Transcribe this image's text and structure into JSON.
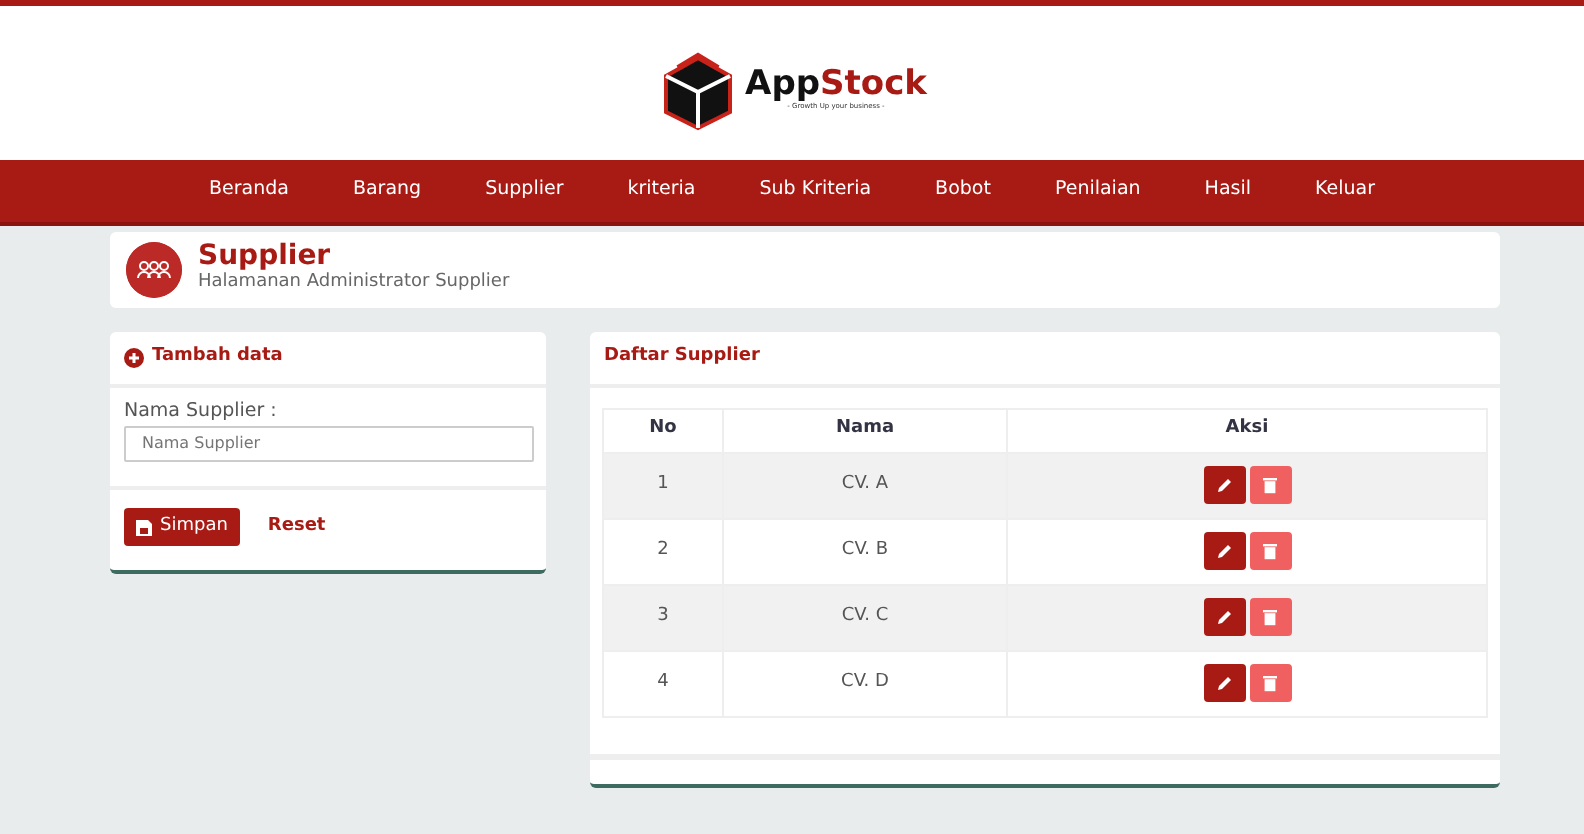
{
  "brand": {
    "name_part1": "App",
    "name_part2": "Stock",
    "tagline": "- Growth Up your business -"
  },
  "nav": [
    "Beranda",
    "Barang",
    "Supplier",
    "kriteria",
    "Sub Kriteria",
    "Bobot",
    "Penilaian",
    "Hasil",
    "Keluar"
  ],
  "page_header": {
    "title": "Supplier",
    "subtitle": "Halamanan Administrator Supplier"
  },
  "form": {
    "title": "Tambah data",
    "label": "Nama Supplier :",
    "placeholder": "Nama Supplier",
    "save": "Simpan",
    "reset": "Reset"
  },
  "table": {
    "title": "Daftar Supplier",
    "columns": [
      "No",
      "Nama",
      "Aksi"
    ],
    "rows": [
      {
        "no": "1",
        "nama": "CV. A"
      },
      {
        "no": "2",
        "nama": "CV. B"
      },
      {
        "no": "3",
        "nama": "CV. C"
      },
      {
        "no": "4",
        "nama": "CV. D"
      }
    ]
  }
}
